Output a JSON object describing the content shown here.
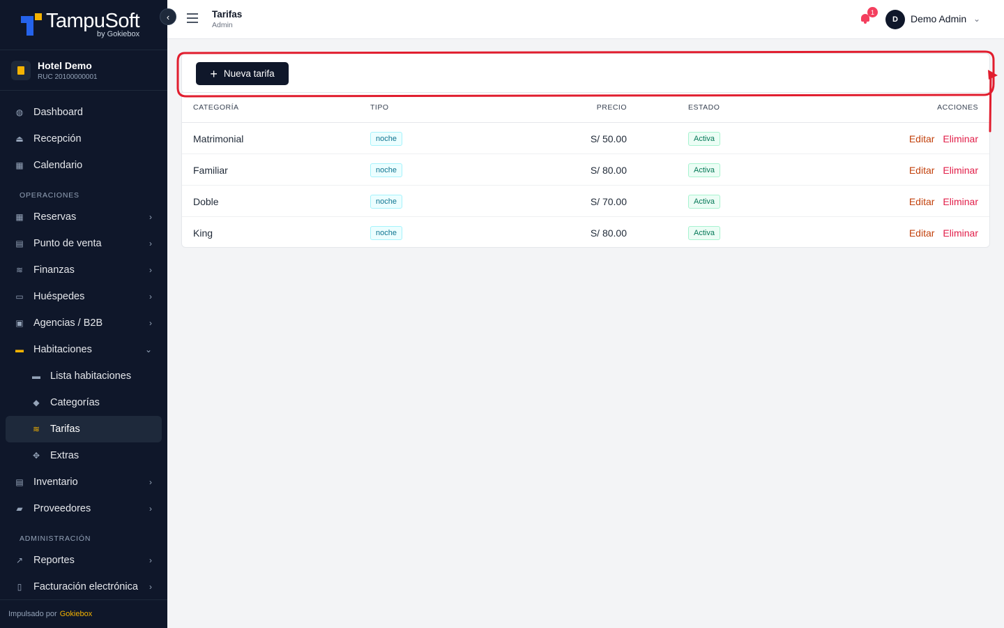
{
  "brand": {
    "name": "TampuSoft",
    "by": "by Gokiebox"
  },
  "hotel": {
    "name": "Hotel Demo",
    "ruc": "RUC 20100000001"
  },
  "nav": {
    "top": [
      {
        "label": "Dashboard",
        "icon": "dashboard-icon"
      },
      {
        "label": "Recepción",
        "icon": "reception-icon"
      },
      {
        "label": "Calendario",
        "icon": "calendar-icon"
      }
    ],
    "operaciones_title": "OPERACIONES",
    "operaciones": [
      {
        "label": "Reservas",
        "icon": "calendar-grid-icon"
      },
      {
        "label": "Punto de venta",
        "icon": "receipt-icon"
      },
      {
        "label": "Finanzas",
        "icon": "coins-icon"
      },
      {
        "label": "Huéspedes",
        "icon": "id-card-icon"
      },
      {
        "label": "Agencias / B2B",
        "icon": "briefcase-icon"
      },
      {
        "label": "Habitaciones",
        "icon": "bed-icon"
      }
    ],
    "habitaciones_sub": [
      {
        "label": "Lista habitaciones",
        "icon": "bed-icon"
      },
      {
        "label": "Categorías",
        "icon": "tag-icon"
      },
      {
        "label": "Tarifas",
        "icon": "coins-icon"
      },
      {
        "label": "Extras",
        "icon": "puzzle-icon"
      }
    ],
    "more": [
      {
        "label": "Inventario",
        "icon": "warehouse-icon"
      },
      {
        "label": "Proveedores",
        "icon": "truck-icon"
      }
    ],
    "admin_title": "ADMINISTRACIÓN",
    "admin": [
      {
        "label": "Reportes",
        "icon": "chart-line-icon"
      },
      {
        "label": "Facturación electrónica",
        "icon": "invoice-icon"
      }
    ]
  },
  "footer": {
    "prefix": "Impulsado por",
    "brand": "Gokiebox"
  },
  "header": {
    "title": "Tarifas",
    "subtitle": "Admin",
    "notifications": "1",
    "avatar_initial": "D",
    "user": "Demo Admin"
  },
  "toolbar": {
    "new_label": "Nueva tarifa"
  },
  "table": {
    "headers": {
      "categoria": "CATEGORÍA",
      "tipo": "TIPO",
      "precio": "PRECIO",
      "estado": "ESTADO",
      "acciones": "ACCIONES"
    },
    "rows": [
      {
        "categoria": "Matrimonial",
        "tipo": "noche",
        "precio": "S/ 50.00",
        "estado": "Activa"
      },
      {
        "categoria": "Familiar",
        "tipo": "noche",
        "precio": "S/ 80.00",
        "estado": "Activa"
      },
      {
        "categoria": "Doble",
        "tipo": "noche",
        "precio": "S/ 70.00",
        "estado": "Activa"
      },
      {
        "categoria": "King",
        "tipo": "noche",
        "precio": "S/ 80.00",
        "estado": "Activa"
      }
    ],
    "actions": {
      "edit": "Editar",
      "delete": "Eliminar"
    }
  },
  "colors": {
    "sidebar": "#0f172a",
    "accent": "#f5b301",
    "annotation": "#e11d2e"
  }
}
